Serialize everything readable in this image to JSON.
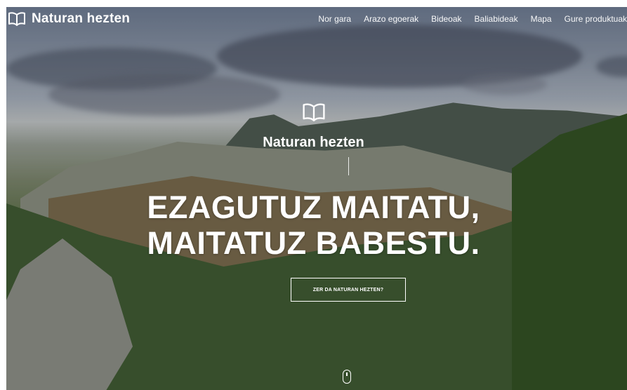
{
  "brand": {
    "name": "Naturan hezten",
    "logo_icon": "open-book-icon"
  },
  "nav": {
    "items": [
      {
        "label": "Nor gara"
      },
      {
        "label": "Arazo egoerak"
      },
      {
        "label": "Bideoak"
      },
      {
        "label": "Baliabideak"
      },
      {
        "label": "Mapa"
      },
      {
        "label": "Gure produktuak"
      }
    ]
  },
  "hero": {
    "brand_name": "Naturan hezten",
    "headline_line1": "EZAGUTUZ MAITATU,",
    "headline_line2": "MAITATUZ BABESTU.",
    "cta_label": "ZER DA NATURAN HEZTEN?",
    "scroll_icon": "mouse-scroll-icon"
  },
  "colors": {
    "text": "#ffffff",
    "accent": "#ffffff"
  }
}
